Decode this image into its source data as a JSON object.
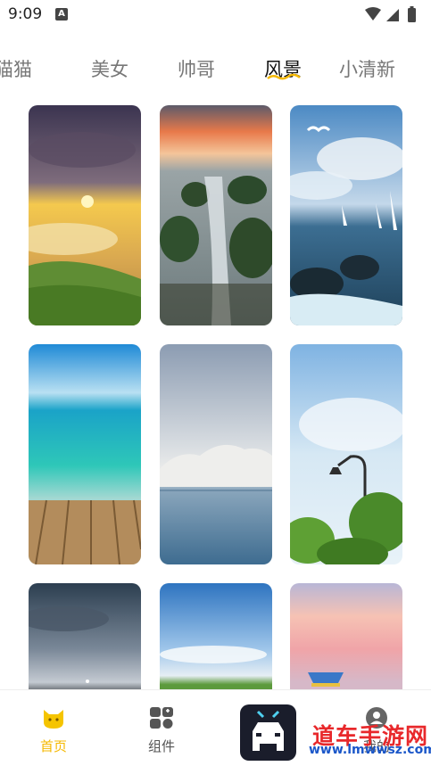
{
  "status": {
    "time": "9:09",
    "notification_icon": "A"
  },
  "tabs": [
    {
      "label": "猫猫",
      "active": false
    },
    {
      "label": "美女",
      "active": false
    },
    {
      "label": "帅哥",
      "active": false
    },
    {
      "label": "风景",
      "active": true
    },
    {
      "label": "小清新",
      "active": false
    }
  ],
  "wallpapers": [
    {
      "name": "sunset-over-clouds",
      "colors": [
        "#3a3350",
        "#7d6a7a",
        "#f6c94a",
        "#5c8a3a"
      ]
    },
    {
      "name": "coastal-rocks-stream",
      "colors": [
        "#e8794a",
        "#9aa4a6",
        "#2c4a2c",
        "#c9d2d4"
      ]
    },
    {
      "name": "sailboats-and-waves",
      "colors": [
        "#4c8ac4",
        "#e9f1f7",
        "#3c6e92",
        "#1a2a33"
      ]
    },
    {
      "name": "tropical-sea-dock",
      "colors": [
        "#2a8fd6",
        "#2ec7b8",
        "#a3d8d2",
        "#b38c5c"
      ]
    },
    {
      "name": "misty-mountain-lake",
      "colors": [
        "#8c9cb2",
        "#d6dbe0",
        "#f0f0ee",
        "#3e6c90"
      ]
    },
    {
      "name": "streetlamp-and-trees",
      "colors": [
        "#8bbbe4",
        "#d6e8f4",
        "#2e2e2e",
        "#4a8a2a"
      ]
    },
    {
      "name": "dusk-clouds-horizon",
      "colors": [
        "#2c3e50",
        "#7a8898",
        "#c4cad2",
        "#1a1f25"
      ]
    },
    {
      "name": "blue-sky-meadow",
      "colors": [
        "#2e74c0",
        "#9fc6ea",
        "#e6eef4",
        "#5c9a3c"
      ]
    },
    {
      "name": "pastel-sunset-boat",
      "colors": [
        "#f6c2b4",
        "#f0a4a8",
        "#b8b6d6",
        "#3a78c8"
      ]
    }
  ],
  "nav": {
    "home_label": "首页",
    "widgets_label": "组件",
    "mine_label": "我的"
  },
  "watermark": {
    "title": "道车手游网",
    "url": "www.lmwwsz.com"
  }
}
